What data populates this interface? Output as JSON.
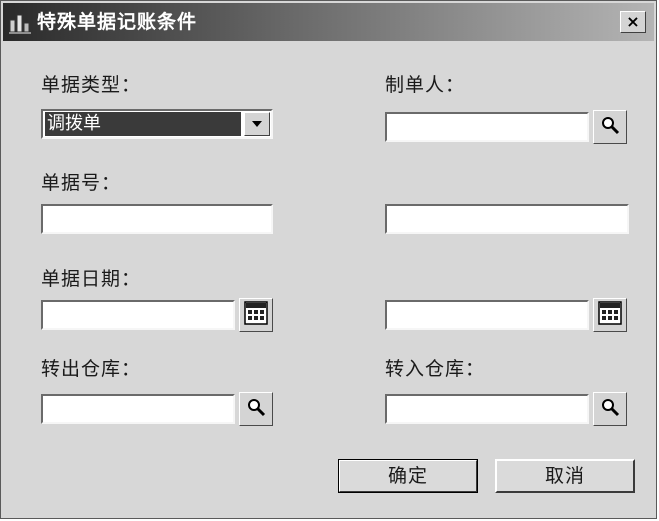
{
  "window": {
    "title": "特殊单据记账条件",
    "close_label": "×"
  },
  "form": {
    "doc_type_label": "单据类型：",
    "doc_type_value": "调拨单",
    "maker_label": "制单人：",
    "maker_value": "",
    "doc_no_label": "单据号：",
    "doc_no_from": "",
    "doc_no_to": "",
    "doc_date_label": "单据日期：",
    "doc_date_from": "",
    "doc_date_to": "",
    "out_wh_label": "转出仓库：",
    "out_wh_value": "",
    "in_wh_label": "转入仓库：",
    "in_wh_value": ""
  },
  "buttons": {
    "ok_label": "确定",
    "cancel_label": "取消"
  },
  "icons": {
    "search": "search-icon",
    "calendar": "calendar-icon",
    "dropdown": "chevron-down-icon",
    "close": "close-icon",
    "app": "app-icon"
  }
}
